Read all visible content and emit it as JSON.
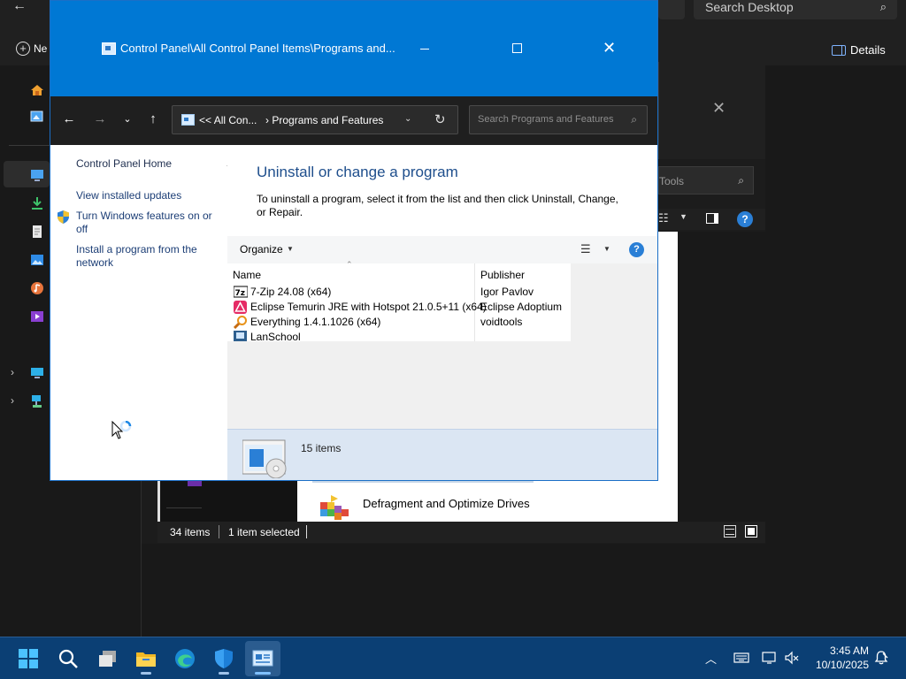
{
  "explorer": {
    "search_placeholder": "Search Desktop",
    "new_label": "Ne",
    "details_label": "Details",
    "sub_search_placeholder": "Tools",
    "item_label": "Defragment and Optimize Drives",
    "status": {
      "count": "34 items",
      "selection": "1 item selected"
    }
  },
  "control_panel": {
    "title": "Control Panel\\All Control Panel Items\\Programs and...",
    "breadcrumb": {
      "prefix": "<<",
      "parent": "All Con...",
      "sep": "›",
      "current": "Programs and Features"
    },
    "search_placeholder": "Search Programs and Features",
    "sidebar": {
      "home": "Control Panel Home",
      "links": [
        "View installed updates",
        "Turn Windows features on or off",
        "Install a program from the network"
      ]
    },
    "heading": "Uninstall or change a program",
    "description": "To uninstall a program, select it from the list and then click Uninstall, Change, or Repair.",
    "toolbar": {
      "organize": "Organize"
    },
    "columns": {
      "name": "Name",
      "publisher": "Publisher"
    },
    "programs": [
      {
        "name": "7-Zip 24.08 (x64)",
        "publisher": "Igor Pavlov",
        "icon": "7zip-icon"
      },
      {
        "name": "Eclipse Temurin JRE with Hotspot 21.0.5+11 (x64)",
        "publisher": "Eclipse Adoptium",
        "icon": "temurin-icon"
      },
      {
        "name": "Everything 1.4.1.1026 (x64)",
        "publisher": "voidtools",
        "icon": "everything-icon"
      },
      {
        "name": "LanSchool",
        "publisher": "",
        "icon": "lanschool-icon"
      }
    ],
    "details": {
      "count": "15 items"
    }
  },
  "taskbar": {
    "apps": [
      "start-icon",
      "search-icon",
      "task-view-icon",
      "file-explorer-icon",
      "edge-icon",
      "defender-icon",
      "control-panel-icon"
    ],
    "time": "3:45 AM",
    "date": "10/10/2025"
  },
  "colors": {
    "accent": "#0078d4",
    "taskbar": "#0b3f74",
    "heading": "#1e4e8c"
  }
}
